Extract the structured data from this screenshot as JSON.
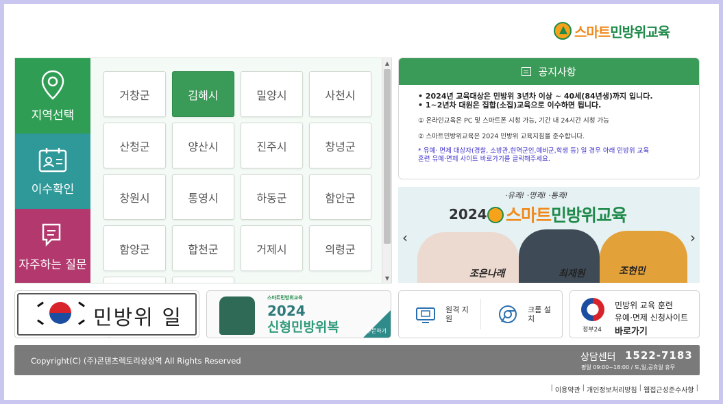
{
  "logo": {
    "text_a": "스마트",
    "text_b": "민방위교육"
  },
  "side_tabs": [
    {
      "label": "지역선택"
    },
    {
      "label": "이수확인"
    },
    {
      "label": "자주하는 질문"
    }
  ],
  "regions": [
    "거창군",
    "김해시",
    "밀양시",
    "사천시",
    "산청군",
    "양산시",
    "진주시",
    "창녕군",
    "창원시",
    "통영시",
    "하동군",
    "함안군",
    "함양군",
    "합천군",
    "거제시",
    "의령군"
  ],
  "active_region": "김해시",
  "notice": {
    "title": "공지사항",
    "line1": "• 2024년 교육대상은 민방위 3년차 이상 ~ 40세(84년생)까지 입니다.",
    "line2": "• 1~2년차 대원은 집합(소집)교육으로 이수하면 됩니다.",
    "line3": "① 온라인교육은 PC 및 스마트폰 시청 가능, 기간 내 24시간 시청 가능",
    "line4": "② 스마트민방위교육은 2024 민방위 교육지침을 준수합니다.",
    "line5": "* 유예· 면제 대상자(경찰, 소방관,현역군인,예비군,학생 등) 일 경우 아래 민방위 교육",
    "line6": "훈련 유예·면제 사이트 바로가기를 클릭해주세요."
  },
  "banner": {
    "cheer": "·유쾌! ·명쾌! ·통쾌!",
    "year": "2024",
    "title_a": "스마트",
    "title_b": "민방위교육",
    "names": [
      "조은나래",
      "최재원",
      "조현민"
    ]
  },
  "bottom": {
    "schedule_label": "민방위 일정",
    "uniform_tag": "스마트민방위교육",
    "uniform_year": "2024",
    "uniform_name": "신형민방위복",
    "uniform_order": "주문하기",
    "remote_label": "원격 지원",
    "chrome_label": "크롬 설치",
    "gov_label": "정부24",
    "gov_line1": "민방위 교육 훈련",
    "gov_line2": "유예·면제 신청사이트",
    "gov_line3": "바로가기"
  },
  "footer": {
    "copyright": "Copyright(C) (주)콘텐츠렉토리상상역 All Rights Reserved",
    "cs_title": "상담센터",
    "cs_phone": "1522-7183",
    "cs_hours": "평일 09:00~18:00 / 토,일,공휴일 휴무"
  },
  "links": [
    "이용약관",
    "개인정보처리방침",
    "웹접근성준수사항"
  ],
  "colors": {
    "green": "#3a9a57",
    "teal": "#2f9898",
    "magenta": "#b2386d",
    "orange": "#f08a1c"
  }
}
